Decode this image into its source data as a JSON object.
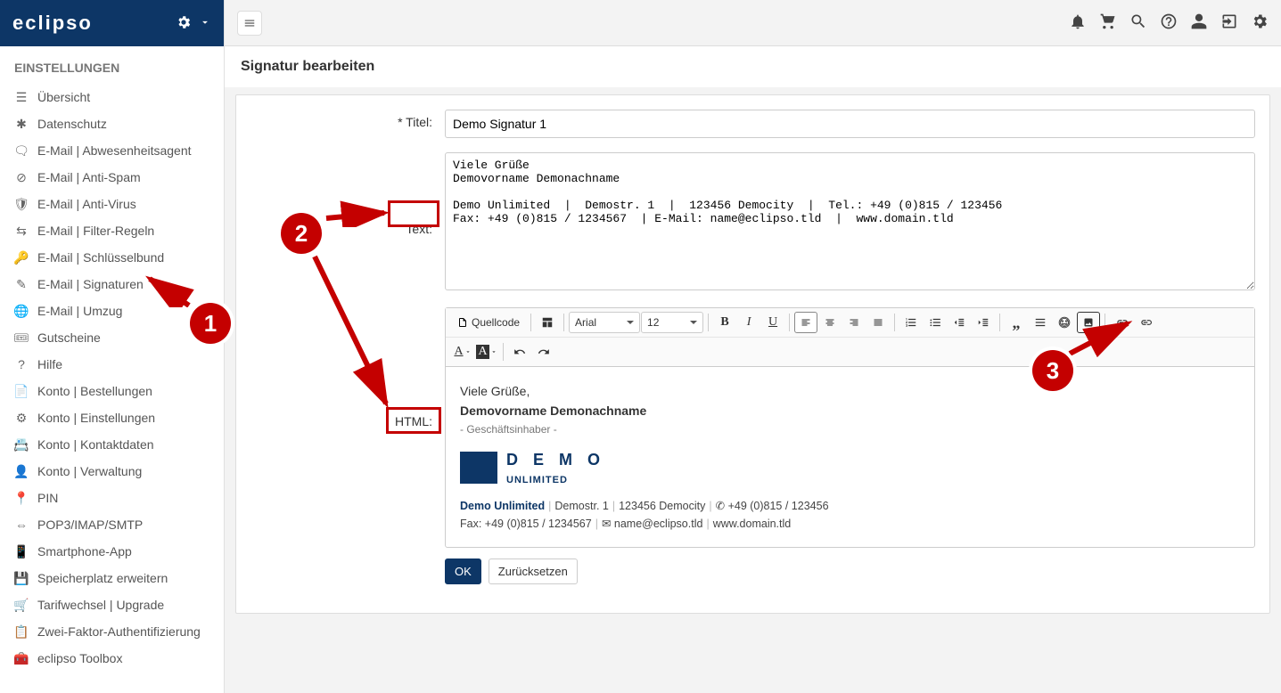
{
  "brand": "eclipso",
  "sidebar": {
    "heading": "EINSTELLUNGEN",
    "items": [
      {
        "label": "Übersicht"
      },
      {
        "label": "Datenschutz"
      },
      {
        "label": "E-Mail | Abwesenheitsagent"
      },
      {
        "label": "E-Mail | Anti-Spam"
      },
      {
        "label": "E-Mail | Anti-Virus"
      },
      {
        "label": "E-Mail | Filter-Regeln"
      },
      {
        "label": "E-Mail | Schlüsselbund"
      },
      {
        "label": "E-Mail | Signaturen"
      },
      {
        "label": "E-Mail | Umzug"
      },
      {
        "label": "Gutscheine"
      },
      {
        "label": "Hilfe"
      },
      {
        "label": "Konto | Bestellungen"
      },
      {
        "label": "Konto | Einstellungen"
      },
      {
        "label": "Konto | Kontaktdaten"
      },
      {
        "label": "Konto | Verwaltung"
      },
      {
        "label": "PIN"
      },
      {
        "label": "POP3/IMAP/SMTP"
      },
      {
        "label": "Smartphone-App"
      },
      {
        "label": "Speicherplatz erweitern"
      },
      {
        "label": "Tarifwechsel | Upgrade"
      },
      {
        "label": "Zwei-Faktor-Authentifizierung"
      },
      {
        "label": "eclipso Toolbox"
      }
    ]
  },
  "page": {
    "title": "Signatur bearbeiten"
  },
  "form": {
    "title_label": "* Titel:",
    "title_value": "Demo Signatur 1",
    "text_label": "Text:",
    "text_value": "Viele Grüße\nDemovorname Demonachname\n\nDemo Unlimited  |  Demostr. 1  |  123456 Democity  |  Tel.: +49 (0)815 / 123456\nFax: +49 (0)815 / 1234567  | E-Mail: name@eclipso.tld  |  www.domain.tld",
    "html_label": "HTML:"
  },
  "editor": {
    "source": "Quellcode",
    "font": "Arial",
    "size": "12",
    "preview": {
      "greeting": "Viele Grüße,",
      "name": "Demovorname Demonachname",
      "role": "- Geschäftsinhaber -",
      "logo_line1": "D E M O",
      "logo_line2": "UNLIMITED",
      "line1": {
        "company": "Demo Unlimited",
        "street": "Demostr. 1",
        "city": "123456 Democity",
        "phone": "+49 (0)815 / 123456"
      },
      "line2": {
        "fax": "Fax: +49 (0)815 / 1234567",
        "email": "name@eclipso.tld",
        "web": "www.domain.tld"
      }
    }
  },
  "buttons": {
    "ok": "OK",
    "reset": "Zurücksetzen"
  },
  "annotations": {
    "n1": "1",
    "n2": "2",
    "n3": "3"
  }
}
